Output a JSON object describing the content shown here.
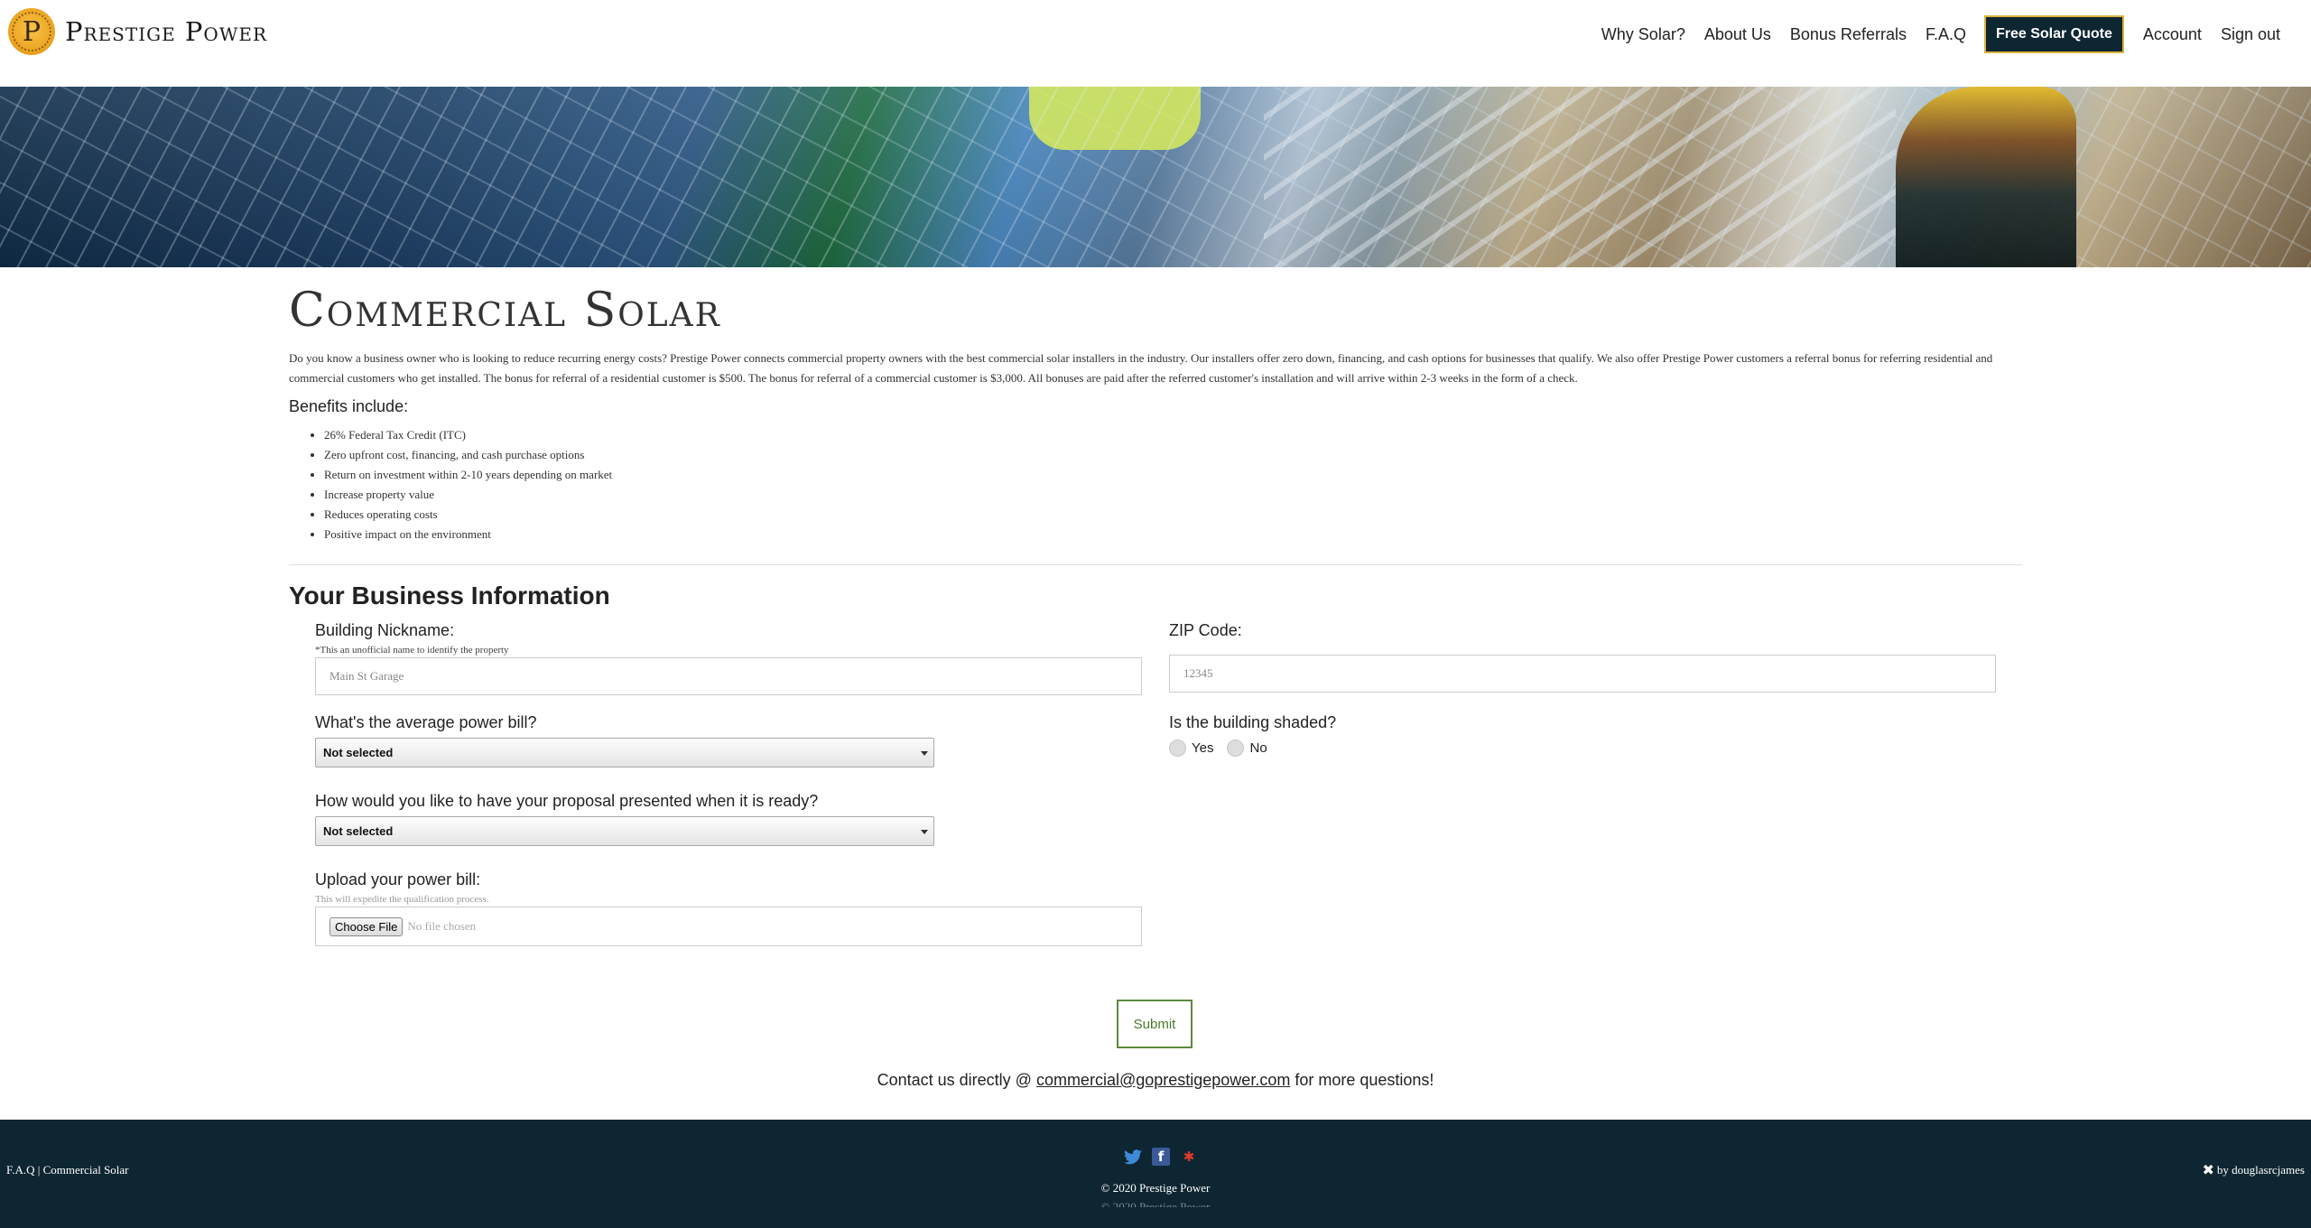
{
  "brand": {
    "name": "Prestige Power",
    "logo_letter": "P"
  },
  "nav": {
    "items": [
      "Why Solar?",
      "About Us",
      "Bonus Referrals",
      "F.A.Q"
    ],
    "quote_label": "Free Solar Quote",
    "account": "Account",
    "signout": "Sign out",
    "quote_border_color": "#d9b441",
    "quote_bg_color": "#0e2632"
  },
  "main": {
    "title": "Commercial Solar",
    "intro": "Do you know a business owner who is looking to reduce recurring energy costs? Prestige Power connects commercial property owners with the best commercial solar installers in the industry. Our installers offer zero down, financing, and cash options for businesses that qualify. We also offer Prestige Power customers a referral bonus for referring residential and commercial customers who get installed. The bonus for referral of a residential customer is $500. The bonus for referral of a commercial customer is $3,000. All bonuses are paid after the referred customer's installation and will arrive within 2-3 weeks in the form of a check.",
    "benefits_title": "Benefits include:",
    "benefits": [
      "26% Federal Tax Credit (ITC)",
      "Zero upfront cost, financing, and cash purchase options",
      "Return on investment within 2-10 years depending on market",
      "Increase property value",
      "Reduces operating costs",
      "Positive impact on the environment"
    ]
  },
  "form": {
    "section_title": "Your Business Information",
    "nickname_label": "Building Nickname:",
    "nickname_hint": "*This an unofficial name to identify the property",
    "nickname_placeholder": "Main St Garage",
    "zip_label": "ZIP Code:",
    "zip_placeholder": "12345",
    "power_bill_label": "What's the average power bill?",
    "power_bill_value": "Not selected",
    "shaded_label": "Is the building shaded?",
    "shaded_yes": "Yes",
    "shaded_no": "No",
    "proposal_label": "How would you like to have your proposal presented when it is ready?",
    "proposal_value": "Not selected",
    "upload_label": "Upload your power bill:",
    "upload_hint": "This will expedite the qualification process.",
    "file_button": "Choose File",
    "file_status": "No file chosen",
    "submit_label": "Submit",
    "submit_color": "#5b8a3c"
  },
  "contact": {
    "prefix": "Contact us directly @ ",
    "email": "commercial@goprestigepower.com",
    "suffix": " for more questions!"
  },
  "footer": {
    "left": "F.A.Q | Commercial Solar",
    "social_icons": [
      "twitter-icon",
      "facebook-icon",
      "yelp-icon"
    ],
    "copyright": "© 2020 Prestige Power",
    "credit": "by douglasrcjames",
    "bg_color": "#0e2632"
  }
}
